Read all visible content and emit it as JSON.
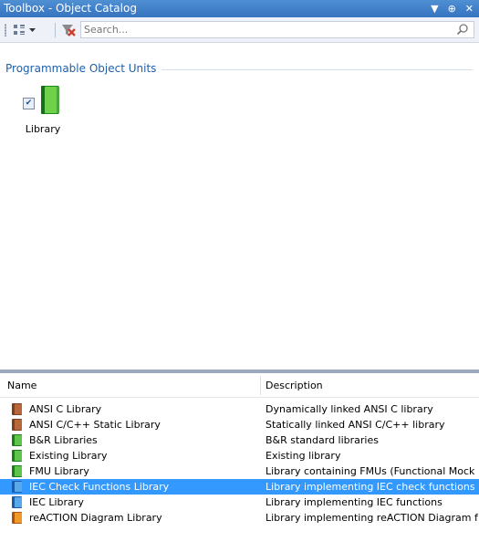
{
  "window": {
    "title": "Toolbox - Object Catalog",
    "controls": [
      "▼",
      "⊕",
      "✕"
    ]
  },
  "toolbar": {
    "search_placeholder": "Search..."
  },
  "catalog": {
    "group_title": "Programmable Object Units",
    "objects": [
      {
        "label": "Library",
        "checked": true
      }
    ]
  },
  "list": {
    "columns": [
      "Name",
      "Description"
    ],
    "rows": [
      {
        "name": "ANSI C Library",
        "description": "Dynamically linked ANSI C library",
        "icon": "brown-book-icon"
      },
      {
        "name": "ANSI C/C++ Static Library",
        "description": "Statically linked ANSI C/C++ library",
        "icon": "brown-book-icon"
      },
      {
        "name": "B&R Libraries",
        "description": "B&R standard libraries",
        "icon": "green-book-icon"
      },
      {
        "name": "Existing Library",
        "description": "Existing library",
        "icon": "green-book-icon"
      },
      {
        "name": "FMU Library",
        "description": "Library containing FMUs (Functional Mock",
        "icon": "green-book-icon"
      },
      {
        "name": "IEC Check Functions Library",
        "description": "Library implementing IEC check functions",
        "icon": "blue-book-icon",
        "selected": true
      },
      {
        "name": "IEC Library",
        "description": "Library implementing IEC functions",
        "icon": "blue-book-icon"
      },
      {
        "name": "reACTION Diagram Library",
        "description": "Library implementing reACTION Diagram f",
        "icon": "orange-book-icon"
      }
    ]
  },
  "colors": {
    "title_bar": "#3674c0",
    "group_text": "#1f5fa8",
    "selection": "#3399ff"
  }
}
